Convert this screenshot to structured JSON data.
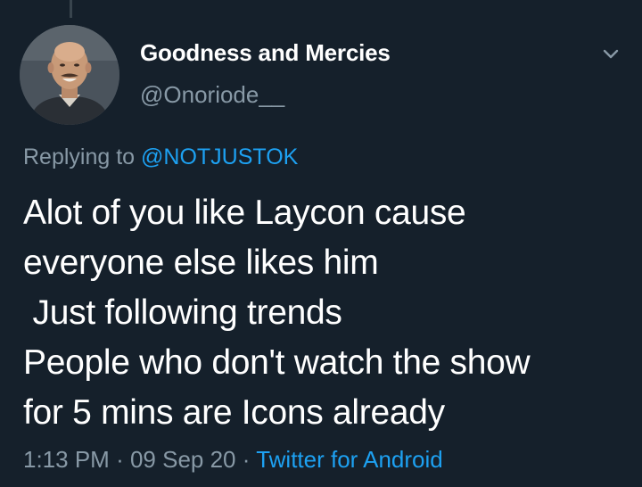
{
  "tweet": {
    "author": {
      "display_name": "Goodness and Mercies",
      "handle": "@Onoriode__",
      "avatar_icon": "profile-photo"
    },
    "menu_icon": "chevron-down-icon",
    "reply": {
      "prefix": "Replying to",
      "mention": "@NOTJUSTOK"
    },
    "text_lines": [
      "Alot of you like Laycon cause",
      "everyone else likes him",
      " Just following trends",
      "People who don't watch the show",
      "for 5 mins are Icons already"
    ],
    "meta": {
      "time": "1:13 PM",
      "date": "09 Sep 20",
      "separator": "·",
      "source": "Twitter for Android"
    }
  },
  "colors": {
    "background": "#15202b",
    "primary_text": "#ffffff",
    "secondary_text": "#8899a6",
    "link": "#1da1f2",
    "thread_line": "#38444d"
  }
}
